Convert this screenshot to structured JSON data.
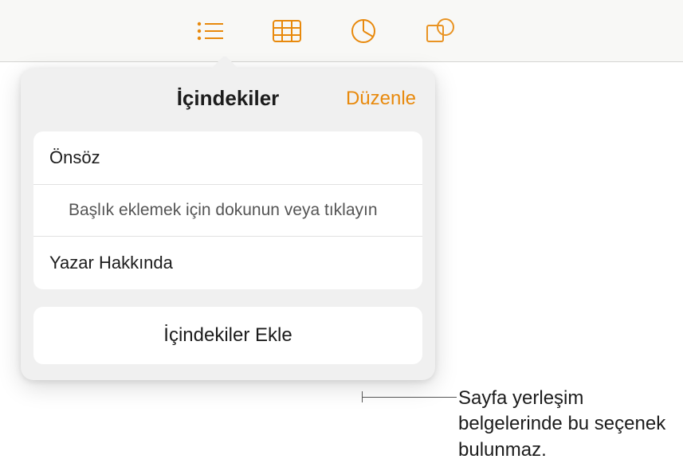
{
  "toolbar": {
    "icons": [
      "toc",
      "table",
      "chart",
      "shape"
    ]
  },
  "popover": {
    "title": "İçindekiler",
    "edit_label": "Düzenle",
    "items": [
      {
        "label": "Önsöz",
        "indent": false
      },
      {
        "label": "Başlık eklemek için dokunun veya tıklayın",
        "indent": true
      },
      {
        "label": "Yazar Hakkında",
        "indent": false
      }
    ],
    "add_button": "İçindekiler Ekle"
  },
  "annotation": {
    "text": "Sayfa yerleşim belgelerinde bu seçenek bulunmaz."
  },
  "colors": {
    "accent": "#e8890c"
  }
}
